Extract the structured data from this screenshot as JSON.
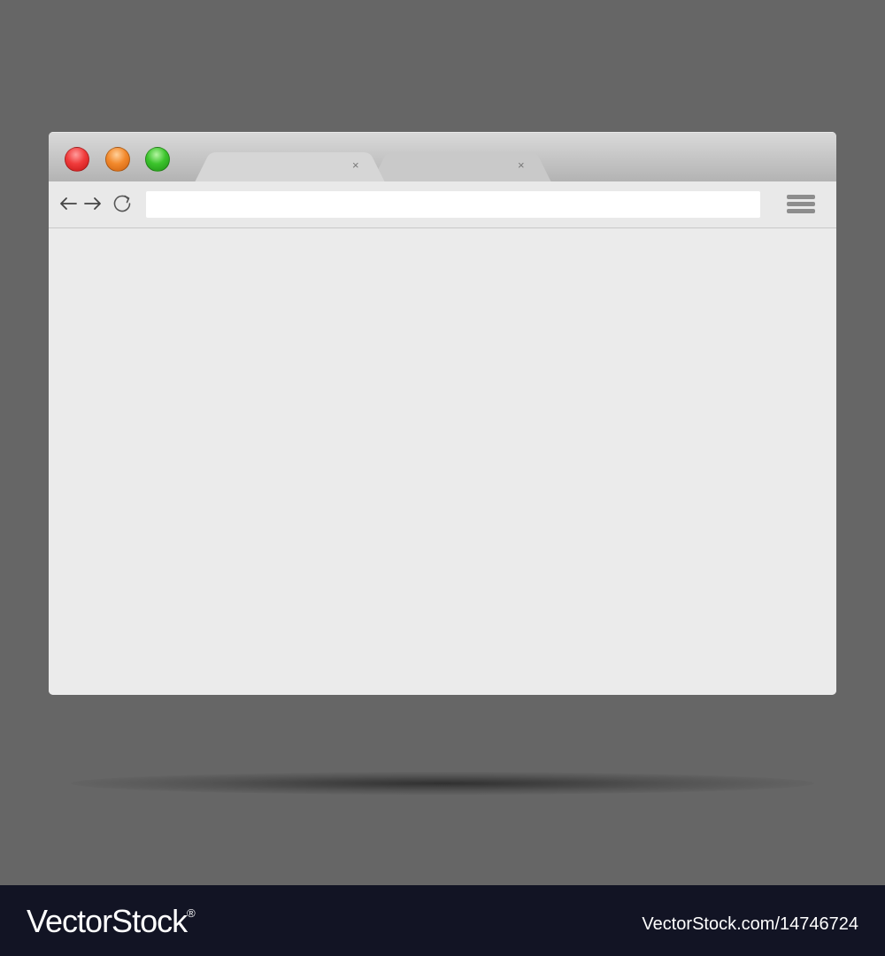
{
  "browser": {
    "window_controls": {
      "close_color": "#f03b3b",
      "minimize_color": "#f2892c",
      "maximize_color": "#3cc42c"
    },
    "tabs": [
      {
        "active": true,
        "close_glyph": "×"
      },
      {
        "active": false,
        "close_glyph": "×"
      }
    ],
    "toolbar": {
      "back_icon": "arrow-left-icon",
      "forward_icon": "arrow-right-icon",
      "reload_icon": "reload-icon",
      "address_value": "",
      "menu_icon": "hamburger-menu-icon"
    },
    "content_background": "#ebebeb"
  },
  "colors": {
    "backdrop": "#666666",
    "footer": "#121424"
  },
  "footer": {
    "brand": "VectorStock",
    "registered_mark": "®",
    "image_id": "VectorStock.com/14746724"
  }
}
